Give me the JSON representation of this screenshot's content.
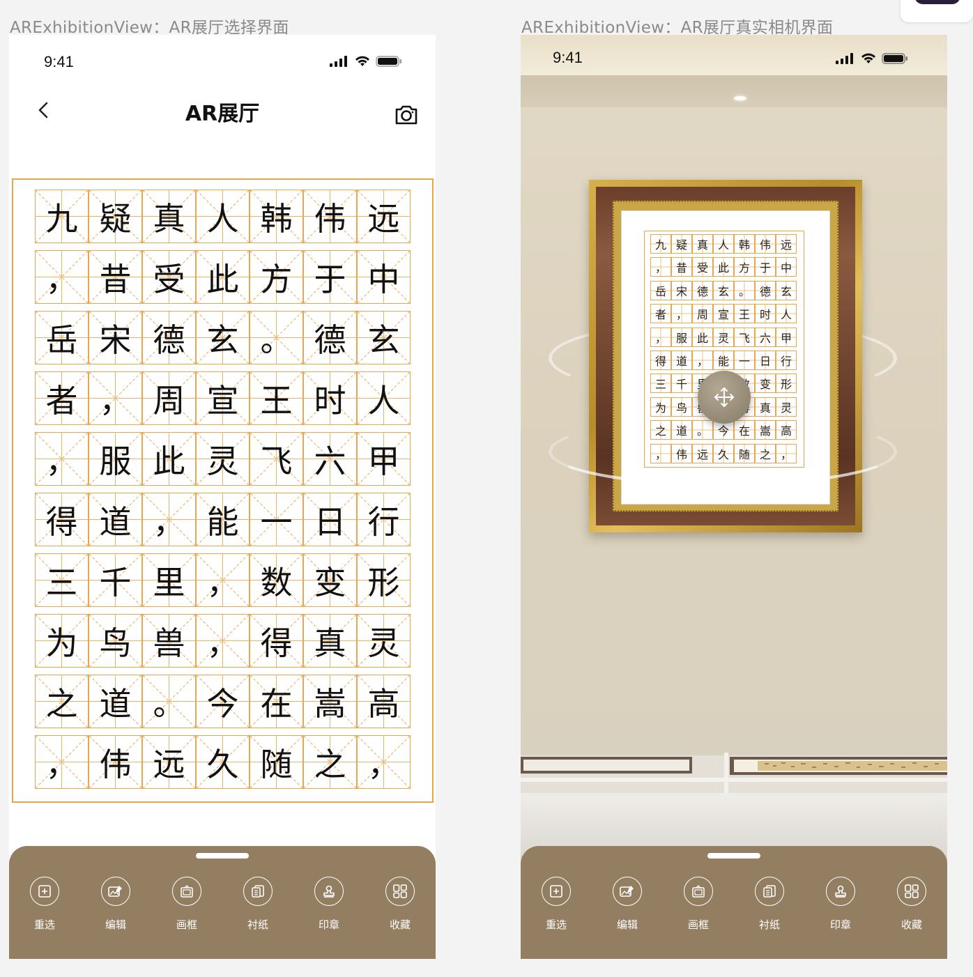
{
  "left": {
    "artboard_label": "ARExhibitionView：AR展厅选择界面",
    "status": {
      "time": "9:41"
    },
    "nav": {
      "title": "AR展厅"
    },
    "rows": [
      [
        "九",
        "疑",
        "真",
        "人",
        "韩",
        "伟",
        "远"
      ],
      [
        "，",
        "昔",
        "受",
        "此",
        "方",
        "于",
        "中"
      ],
      [
        "岳",
        "宋",
        "德",
        "玄",
        "。",
        "德",
        "玄"
      ],
      [
        "者",
        "，",
        "周",
        "宣",
        "王",
        "时",
        "人"
      ],
      [
        "，",
        "服",
        "此",
        "灵",
        "飞",
        "六",
        "甲"
      ],
      [
        "得",
        "道",
        "，",
        "能",
        "一",
        "日",
        "行"
      ],
      [
        "三",
        "千",
        "里",
        "，",
        "数",
        "变",
        "形"
      ],
      [
        "为",
        "鸟",
        "兽",
        "，",
        "得",
        "真",
        "灵"
      ],
      [
        "之",
        "道",
        "。",
        "今",
        "在",
        "嵩",
        "高"
      ],
      [
        "，",
        "伟",
        "远",
        "久",
        "随",
        "之",
        "，"
      ]
    ],
    "toolbar": [
      {
        "label": "重选",
        "icon": "plus-square-icon"
      },
      {
        "label": "编辑",
        "icon": "image-edit-icon"
      },
      {
        "label": "画框",
        "icon": "frame-icon"
      },
      {
        "label": "衬纸",
        "icon": "paper-icon"
      },
      {
        "label": "印章",
        "icon": "stamp-icon"
      },
      {
        "label": "收藏",
        "icon": "grid-icon"
      }
    ]
  },
  "right": {
    "artboard_label": "ARExhibitionView：AR展厅真实相机界面",
    "status": {
      "time": "9:41"
    },
    "toolbar": [
      {
        "label": "重选",
        "icon": "plus-square-icon"
      },
      {
        "label": "编辑",
        "icon": "image-edit-icon"
      },
      {
        "label": "画框",
        "icon": "frame-icon"
      },
      {
        "label": "衬纸",
        "icon": "paper-icon"
      },
      {
        "label": "印章",
        "icon": "stamp-icon"
      },
      {
        "label": "收藏",
        "icon": "grid-icon"
      }
    ]
  },
  "colors": {
    "sheet": "#947e62",
    "grid_line": "#e7a650",
    "paper_border": "#e8a547"
  }
}
